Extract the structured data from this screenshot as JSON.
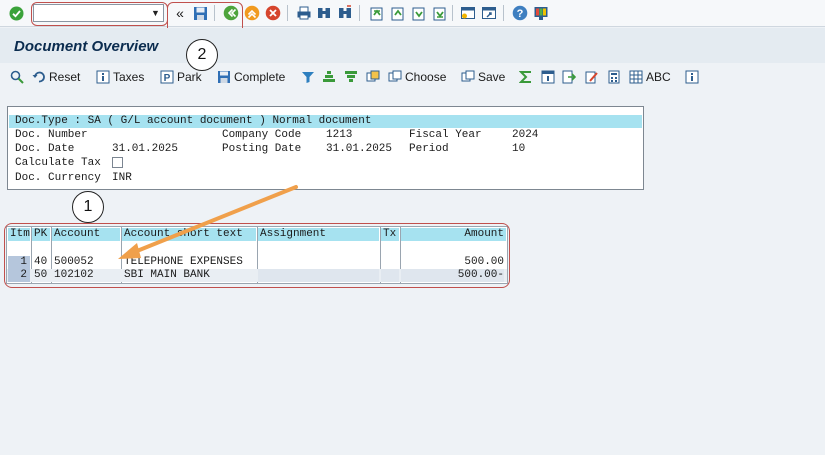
{
  "system_toolbar": {
    "command_field_value": "",
    "back_glyph": "«",
    "icons": [
      "enter-icon",
      "save-icon",
      "back-icon",
      "exit-icon",
      "cancel-icon",
      "print-icon",
      "find-icon",
      "find-next-icon",
      "first-page-icon",
      "previous-page-icon",
      "next-page-icon",
      "last-page-icon",
      "create-session-icon",
      "shortcut-icon",
      "help-icon",
      "customize-layout-icon"
    ]
  },
  "title": "Document Overview",
  "app_toolbar": {
    "reset": "Reset",
    "taxes": "Taxes",
    "park": "Park",
    "complete": "Complete",
    "choose": "Choose",
    "save": "Save",
    "abc": "ABC"
  },
  "header": {
    "doc_type_line": "Doc.Type : SA ( G/L account document ) Normal document",
    "doc_number_label": "Doc. Number",
    "doc_number_value": "",
    "company_code_label": "Company Code",
    "company_code_value": "1213",
    "fiscal_year_label": "Fiscal Year",
    "fiscal_year_value": "2024",
    "doc_date_label": "Doc. Date",
    "doc_date_value": "31.01.2025",
    "posting_date_label": "Posting Date",
    "posting_date_value": "31.01.2025",
    "period_label": "Period",
    "period_value": "10",
    "calculate_tax_label": "Calculate Tax",
    "calculate_tax_checked": false,
    "doc_currency_label": "Doc. Currency",
    "doc_currency_value": "INR"
  },
  "table": {
    "columns": [
      "Itm",
      "PK",
      "Account",
      "Account short text",
      "Assignment",
      "Tx",
      "Amount"
    ],
    "rows": [
      {
        "itm": "1",
        "pk": "40",
        "account": "500052",
        "text": "TELEPHONE EXPENSES",
        "assignment": "",
        "tx": "",
        "amount": "500.00"
      },
      {
        "itm": "2",
        "pk": "50",
        "account": "102102",
        "text": "SBI MAIN BANK",
        "assignment": "",
        "tx": "",
        "amount": "500.00-"
      }
    ]
  },
  "annotations": {
    "marker_1": "1",
    "marker_2": "2",
    "highlight_color": "#c0504d",
    "arrow_color": "#f0a04b"
  },
  "colors": {
    "header_highlight": "#a6e2f0",
    "title_text": "#0b2c4f"
  }
}
